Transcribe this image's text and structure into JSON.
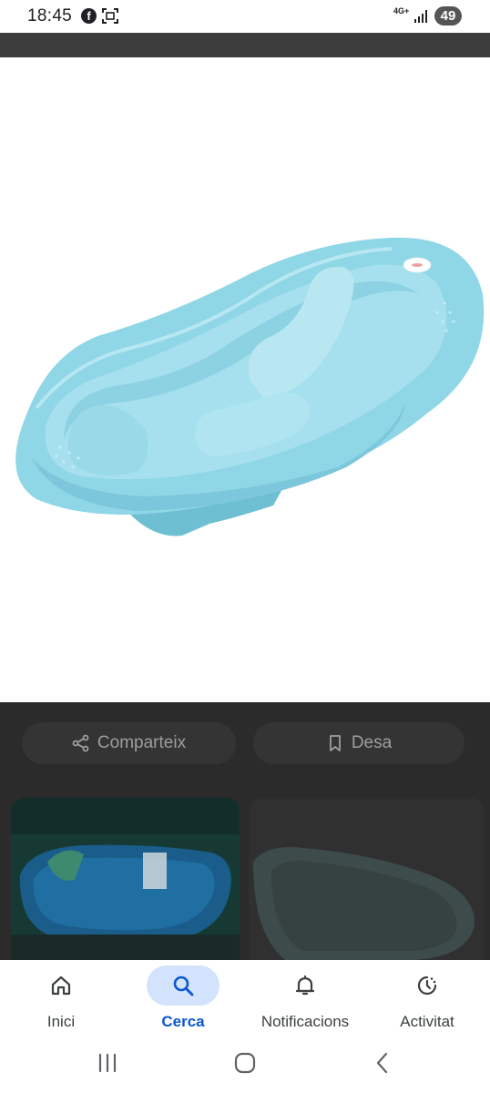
{
  "status_bar": {
    "time": "18:45",
    "network": "4G+",
    "battery": "49",
    "icons": [
      "facebook-icon",
      "screenshot-icon",
      "signal-icon",
      "battery-icon"
    ]
  },
  "image": {
    "subject": "light blue baby bath tub",
    "main_color": "#8fd3e3"
  },
  "actions": {
    "share_label": "Comparteix",
    "save_label": "Desa"
  },
  "bottom_nav": {
    "items": [
      {
        "label": "Inici",
        "icon": "home-icon",
        "active": false
      },
      {
        "label": "Cerca",
        "icon": "search-icon",
        "active": true
      },
      {
        "label": "Notificacions",
        "icon": "bell-icon",
        "active": false
      },
      {
        "label": "Activitat",
        "icon": "activity-icon",
        "active": false
      }
    ]
  },
  "system_nav": {
    "icons": [
      "recents-icon",
      "home-circle-icon",
      "back-icon"
    ]
  },
  "colors": {
    "accent": "#0b57d0",
    "active_pill": "#d3e3fd",
    "dim_overlay": "#2b2b2b"
  }
}
